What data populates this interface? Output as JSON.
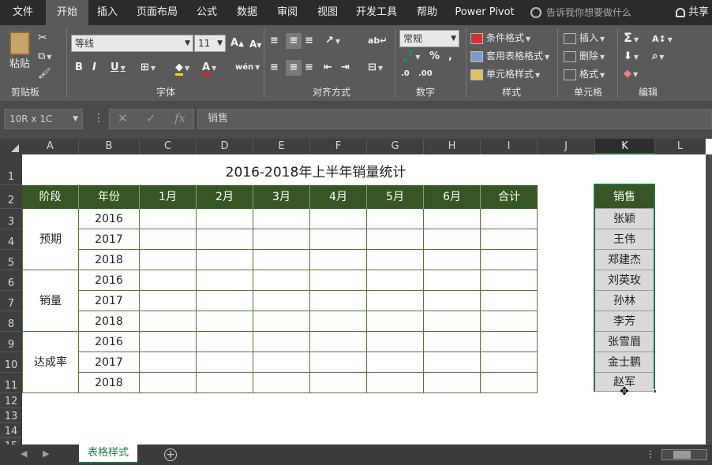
{
  "tabs": [
    "文件",
    "开始",
    "插入",
    "页面布局",
    "公式",
    "数据",
    "审阅",
    "视图",
    "开发工具",
    "帮助",
    "Power Pivot"
  ],
  "active_tab": "开始",
  "tell_me": "告诉我你想要做什么",
  "share": "共享",
  "ribbon": {
    "paste": "粘贴",
    "clipboard_label": "剪贴板",
    "font_name": "等线",
    "font_size": "11",
    "font_label": "字体",
    "align_label": "对齐方式",
    "number_format": "常规",
    "number_label": "数字",
    "cond_format": "条件格式",
    "table_format": "套用表格格式",
    "cell_style": "单元格样式",
    "styles_label": "样式",
    "insert": "插入",
    "delete": "删除",
    "format": "格式",
    "cells_label": "单元格",
    "edit_label": "编辑"
  },
  "formula_bar": {
    "name_box": "10R x 1C",
    "formula": "销售"
  },
  "columns": [
    "A",
    "B",
    "C",
    "D",
    "E",
    "F",
    "G",
    "H",
    "I",
    "J",
    "K",
    "L"
  ],
  "rows": [
    "1",
    "2",
    "3",
    "4",
    "5",
    "6",
    "7",
    "8",
    "9",
    "10",
    "11",
    "12",
    "13",
    "14",
    "15"
  ],
  "sheet": {
    "title": "2016-2018年上半年销量统计",
    "headers": [
      "阶段",
      "年份",
      "1月",
      "2月",
      "3月",
      "4月",
      "5月",
      "6月",
      "合计"
    ],
    "stages": [
      "预期",
      "销量",
      "达成率"
    ],
    "years": [
      "2016",
      "2017",
      "2018",
      "2016",
      "2017",
      "2018",
      "2016",
      "2017",
      "2018"
    ],
    "k_header": "销售",
    "k_names": [
      "张颖",
      "王伟",
      "郑建杰",
      "刘英玫",
      "孙林",
      "李芳",
      "张雪眉",
      "金士鹏",
      "赵军"
    ]
  },
  "sheet_tab": "表格样式"
}
